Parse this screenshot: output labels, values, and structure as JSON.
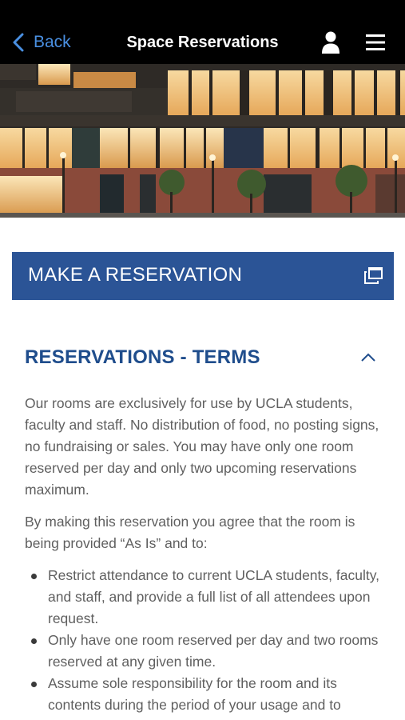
{
  "header": {
    "back_label": "Back",
    "title": "Space Reservations",
    "back_icon": "chevron-left-icon",
    "user_icon": "user-icon",
    "menu_icon": "hamburger-menu-icon"
  },
  "hero": {
    "image": "building-exterior-night-photo"
  },
  "reserve": {
    "label": "MAKE A RESERVATION",
    "icon": "external-window-icon"
  },
  "terms": {
    "title": "RESERVATIONS - TERMS",
    "toggle_icon": "chevron-up-icon",
    "intro": "Our rooms are exclusively for use by UCLA students, faculty and staff. No distribution of food, no posting signs, no fundraising or sales. You may have only one room reserved per day and only two upcoming reservations maximum.",
    "agreement": "By making this reservation you agree that the room is being provided “As Is” and to:",
    "items": [
      "Restrict attendance to current UCLA students, faculty, and staff, and provide a full list of all attendees upon request.",
      "Only have one room reserved per day and two rooms reserved at any given time.",
      "Assume sole responsibility for the room and its contents during the period of your usage and to"
    ]
  },
  "colors": {
    "header_bg": "#000000",
    "link_blue": "#4a90e2",
    "button_blue": "#2b5496",
    "heading_blue": "#1f4d8c",
    "body_text": "#5f5f5f"
  }
}
